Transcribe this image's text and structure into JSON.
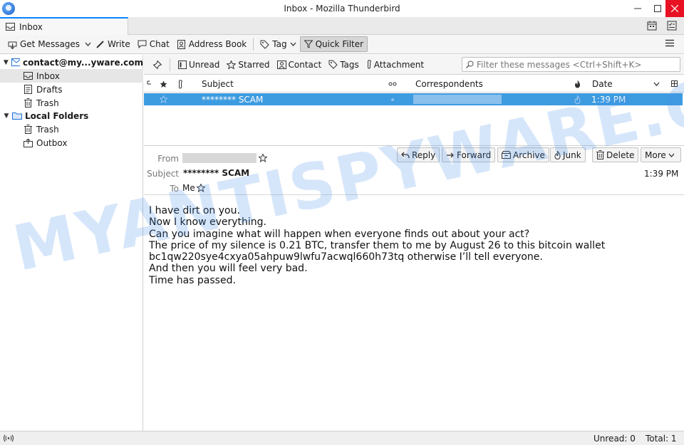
{
  "window": {
    "title": "Inbox - Mozilla Thunderbird"
  },
  "tabs": [
    {
      "label": "Inbox"
    }
  ],
  "toolbar": {
    "get_messages": "Get Messages",
    "write": "Write",
    "chat": "Chat",
    "address_book": "Address Book",
    "tag": "Tag",
    "quick_filter": "Quick Filter"
  },
  "folders": {
    "account": "contact@my...yware.com",
    "inbox": "Inbox",
    "drafts": "Drafts",
    "trash": "Trash",
    "local_folders": "Local Folders",
    "local_trash": "Trash",
    "outbox": "Outbox"
  },
  "quick_filter": {
    "unread": "Unread",
    "starred": "Starred",
    "contact": "Contact",
    "tags": "Tags",
    "attachment": "Attachment",
    "search_placeholder": "Filter these messages <Ctrl+Shift+K>"
  },
  "thread_columns": {
    "subject": "Subject",
    "correspondents": "Correspondents",
    "date": "Date"
  },
  "messages": [
    {
      "subject": "******** SCAM",
      "date": "1:39 PM"
    }
  ],
  "message_header": {
    "from_label": "From",
    "subject_label": "Subject",
    "subject": "******** SCAM",
    "to_label": "To",
    "to": "Me",
    "date": "1:39 PM",
    "actions": {
      "reply": "Reply",
      "forward": "Forward",
      "archive": "Archive",
      "junk": "Junk",
      "delete": "Delete",
      "more": "More"
    }
  },
  "message_body": [
    "I have dirt on you.",
    "Now I know everything.",
    "Can you imagine what will happen when everyone finds out about your act?",
    "The price of my silence is 0.21 BTC, transfer them to me by August 26 to this bitcoin wallet",
    "bc1qw220sye4cxya05ahpuw9lwfu7acwql660h73tq otherwise I’ll tell everyone.",
    "And then you will feel very bad.",
    "Time has passed."
  ],
  "status": {
    "unread": "Unread: 0",
    "total": "Total: 1"
  },
  "watermark": "MYANTISPYWARE.COM",
  "colors": {
    "selection": "#3d9be0",
    "accent": "#0a84ff",
    "close_button": "#e81123"
  }
}
